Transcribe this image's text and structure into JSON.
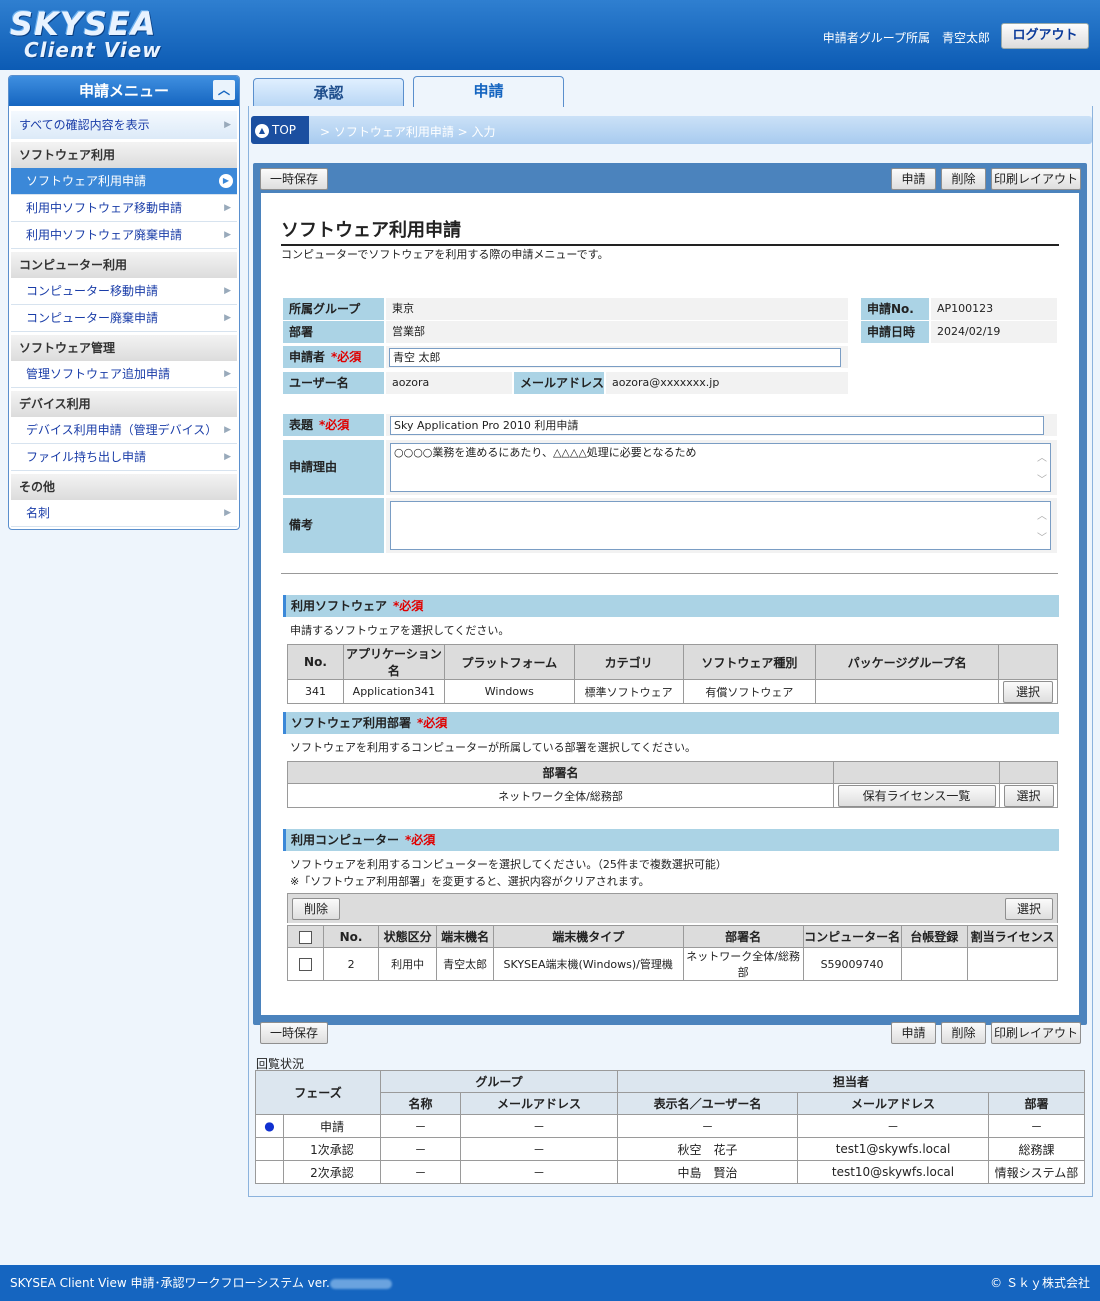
{
  "header": {
    "logo_line1": "SKYSEA",
    "logo_line2": "Client View",
    "user_info": "申請者グループ所属　青空太郎",
    "logout_label": "ログアウト"
  },
  "sidebar": {
    "title": "申請メニュー",
    "collapse_icon": "chevron-up-icon",
    "show_all": "すべての確認内容を表示",
    "groups": [
      {
        "label": "ソフトウェア利用",
        "items": [
          "ソフトウェア利用申請",
          "利用中ソフトウェア移動申請",
          "利用中ソフトウェア廃棄申請"
        ]
      },
      {
        "label": "コンピューター利用",
        "items": [
          "コンピューター移動申請",
          "コンピューター廃棄申請"
        ]
      },
      {
        "label": "ソフトウェア管理",
        "items": [
          "管理ソフトウェア追加申請"
        ]
      },
      {
        "label": "デバイス利用",
        "items": [
          "デバイス利用申請（管理デバイス）",
          "ファイル持ち出し申請"
        ]
      },
      {
        "label": "その他",
        "items": [
          "名刺"
        ]
      }
    ]
  },
  "tabs": {
    "approve": "承認",
    "apply": "申請"
  },
  "breadcrumb": {
    "top": "TOP",
    "path": "> ソフトウェア利用申請 > 入力"
  },
  "toolbar": {
    "save": "一時保存",
    "apply": "申請",
    "delete": "削除",
    "print": "印刷レイアウト"
  },
  "form": {
    "title": "ソフトウェア利用申請",
    "description": "コンピューターでソフトウェアを利用する際の申請メニューです。",
    "required": "*必須",
    "group_label": "所属グループ",
    "group_value": "東京",
    "dept_label": "部署",
    "dept_value": "営業部",
    "applicant_label": "申請者",
    "applicant_value": "青空 太郎",
    "username_label": "ユーザー名",
    "username_value": "aozora",
    "mail_label": "メールアドレス",
    "mail_value": "aozora@xxxxxxx.jp",
    "appno_label": "申請No.",
    "appno_value": "AP100123",
    "appdate_label": "申請日時",
    "appdate_value": "2024/02/19",
    "subject_label": "表題",
    "subject_value": "Sky Application Pro 2010 利用申請",
    "reason_label": "申請理由",
    "reason_value": "○○○○業務を進めるにあたり、△△△△処理に必要となるため",
    "remarks_label": "備考",
    "remarks_value": ""
  },
  "software": {
    "title": "利用ソフトウェア",
    "desc": "申請するソフトウェアを選択してください。",
    "headers": [
      "No.",
      "アプリケーション名",
      "プラットフォーム",
      "カテゴリ",
      "ソフトウェア種別",
      "パッケージグループ名",
      ""
    ],
    "row": [
      "341",
      "Application341",
      "Windows",
      "標準ソフトウェア",
      "有償ソフトウェア",
      ""
    ],
    "select": "選択"
  },
  "department": {
    "title": "ソフトウェア利用部署",
    "desc": "ソフトウェアを利用するコンピューターが所属している部署を選択してください。",
    "header": "部署名",
    "value": "ネットワーク全体/総務部",
    "license_button": "保有ライセンス一覧",
    "select": "選択"
  },
  "computer": {
    "title": "利用コンピューター",
    "desc1": "ソフトウェアを利用するコンピューターを選択してください。（25件まで複数選択可能）",
    "desc2": "※「ソフトウェア利用部署」を変更すると、選択内容がクリアされます。",
    "delete": "削除",
    "select": "選択",
    "headers": [
      "No.",
      "状態区分",
      "端末機名",
      "端末機タイプ",
      "部署名",
      "コンピューター名",
      "台帳登録",
      "割当ライセンス"
    ],
    "row": [
      "2",
      "利用中",
      "青空太郎",
      "SKYSEA端末機(Windows)/管理機",
      "ネットワーク全体/総務部",
      "S59009740",
      "",
      ""
    ]
  },
  "route": {
    "label": "回覧状況",
    "phase": "フェーズ",
    "group": "グループ",
    "person": "担当者",
    "sub_headers": [
      "名称",
      "メールアドレス",
      "表示名／ユーザー名",
      "メールアドレス",
      "部署"
    ],
    "rows": [
      {
        "mark": "●",
        "phase": "申請",
        "g_name": "－",
        "g_mail": "－",
        "p_name": "－",
        "p_mail": "－",
        "p_dept": "－"
      },
      {
        "mark": "",
        "phase": "1次承認",
        "g_name": "－",
        "g_mail": "－",
        "p_name": "秋空　花子",
        "p_mail": "test1@skywfs.local",
        "p_dept": "総務課"
      },
      {
        "mark": "",
        "phase": "2次承認",
        "g_name": "－",
        "g_mail": "－",
        "p_name": "中島　賢治",
        "p_mail": "test10@skywfs.local",
        "p_dept": "情報システム部"
      }
    ]
  },
  "footer": {
    "left": "SKYSEA Client View 申請･承認ワークフローシステム ver.",
    "right": "© Ｓｋｙ株式会社"
  }
}
